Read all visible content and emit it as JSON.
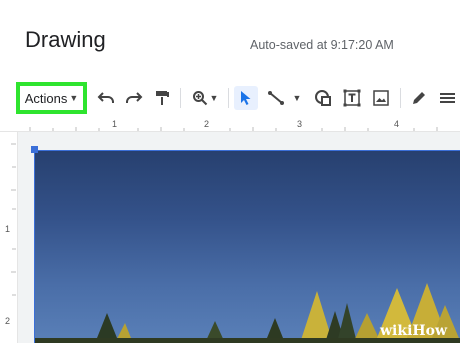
{
  "window": {
    "title": "Drawing",
    "autosave": "Auto-saved at 9:17:20 AM"
  },
  "toolbar": {
    "actions_label": "Actions",
    "highlight_color": "#2ee42e",
    "icons": [
      "undo-icon",
      "redo-icon",
      "paint-format-icon",
      "zoom-icon",
      "select-icon",
      "line-icon",
      "shape-icon",
      "text-box-icon",
      "image-icon",
      "pen-icon",
      "more-icon"
    ]
  },
  "ruler": {
    "top_marks": [
      "1",
      "2",
      "3",
      "4"
    ],
    "left_marks": [
      "1",
      "2"
    ]
  },
  "watermark": {
    "prefix": "wiki",
    "suffix": "How"
  },
  "colors": {
    "selection": "#3b6fd8",
    "sky": "#34528a"
  }
}
